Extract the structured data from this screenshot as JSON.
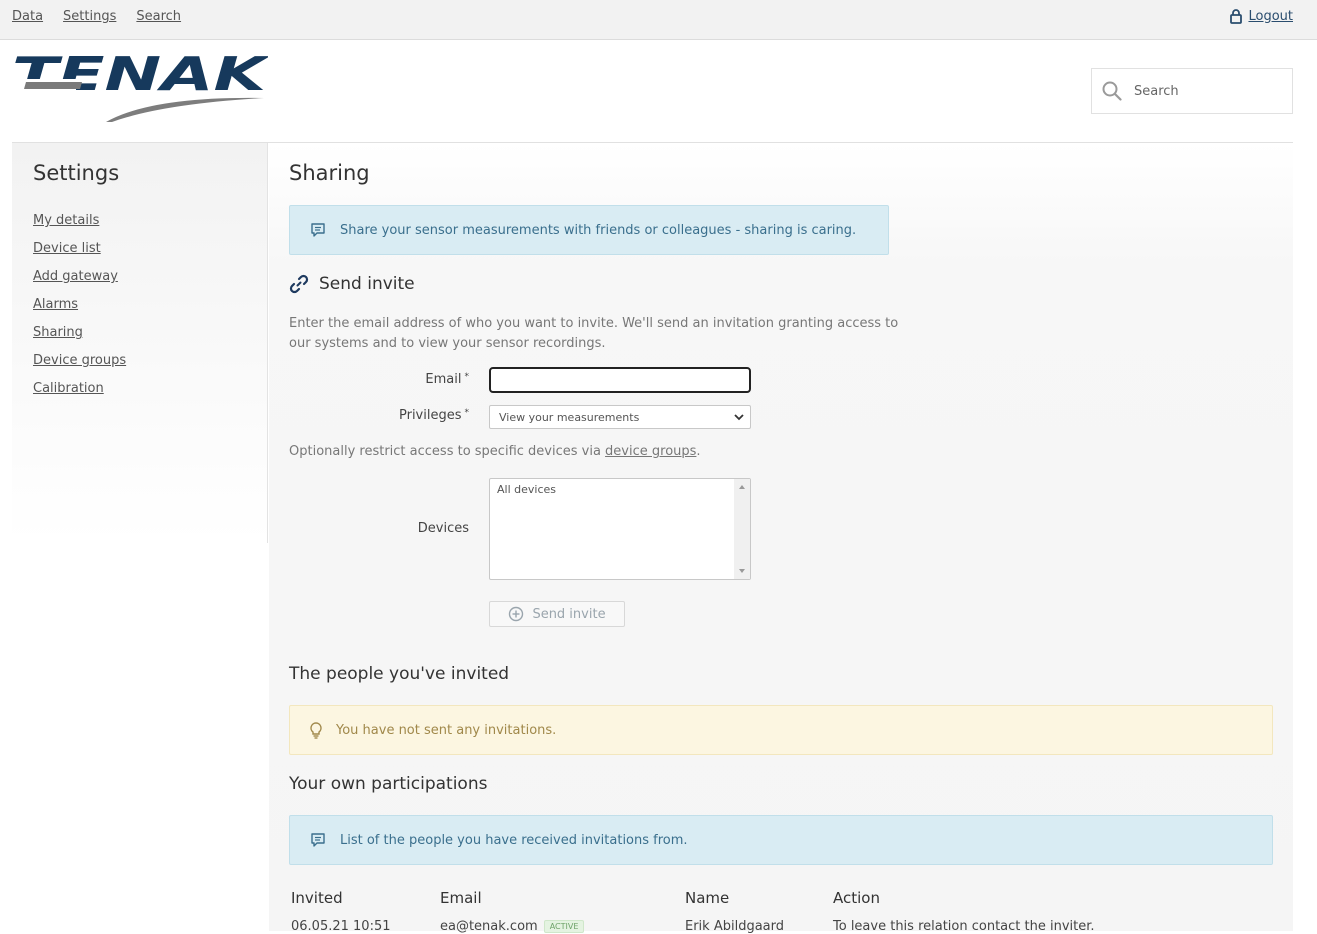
{
  "topnav": {
    "data": "Data",
    "settings": "Settings",
    "search": "Search",
    "logout": "Logout"
  },
  "logo": {
    "text": "TENAK"
  },
  "search": {
    "placeholder": "Search"
  },
  "sidebar": {
    "title": "Settings",
    "items": [
      {
        "label": "My details"
      },
      {
        "label": "Device list"
      },
      {
        "label": "Add gateway"
      },
      {
        "label": "Alarms"
      },
      {
        "label": "Sharing"
      },
      {
        "label": "Device groups"
      },
      {
        "label": "Calibration"
      }
    ]
  },
  "main": {
    "title": "Sharing",
    "share_info": "Share your sensor measurements with friends or colleagues - sharing is caring.",
    "send_invite_heading": "Send invite",
    "description": "Enter the email address of who you want to invite. We'll send an invitation granting access to our systems and to view your sensor recordings.",
    "email_label": "Email",
    "privileges_label": "Privileges",
    "required_marker": "*",
    "privileges_selected": "View your measurements",
    "optional_text": "Optionally restrict access to specific devices via ",
    "optional_link": "device groups",
    "optional_end": ".",
    "devices_label": "Devices",
    "devices_option": "All devices",
    "send_button": "Send invite",
    "invited_heading": "The people you've invited",
    "no_invites": "You have not sent any invitations.",
    "participations_heading": "Your own participations",
    "participations_info": "List of the people you have received invitations from.",
    "table": {
      "headers": [
        "Invited",
        "Email",
        "Name",
        "Action"
      ],
      "rows": [
        {
          "invited": "06.05.21 10:51",
          "email": "ea@tenak.com",
          "status": "ACTIVE",
          "name": "Erik Abildgaard",
          "action": "To leave this relation contact the inviter."
        }
      ]
    }
  },
  "colors": {
    "accent": "#1e3a5f",
    "info_bg": "#d9ecf3",
    "warn_bg": "#fcf6e1",
    "badge": "#e4f3e1"
  }
}
